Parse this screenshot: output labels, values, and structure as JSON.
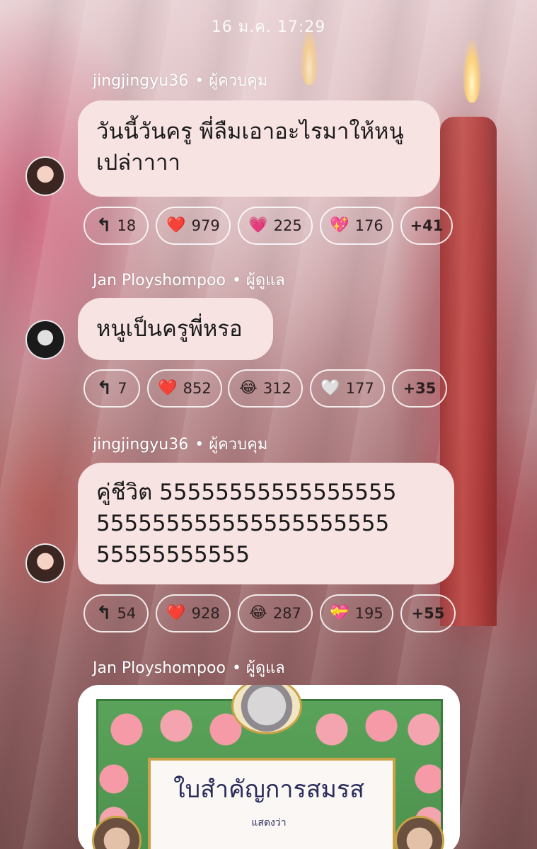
{
  "timestamp": "16 ม.ค. 17:29",
  "messages": [
    {
      "sender": "jingjingyu36",
      "role": "• ผู้ควบคุม",
      "text": "วันนี้วันครู พี่ลืมเอาอะไรมาให้หนูเปล่าาาา",
      "reactions": [
        {
          "icon": "reply-icon",
          "glyph": "↰",
          "count": "18"
        },
        {
          "icon": "red-heart-icon",
          "glyph": "❤️",
          "count": "979"
        },
        {
          "icon": "pink-heart-icon",
          "glyph": "💗",
          "count": "225"
        },
        {
          "icon": "sparkling-heart-icon",
          "glyph": "💖",
          "count": "176"
        },
        {
          "icon": "more-icon",
          "glyph": "",
          "count": "+41"
        }
      ]
    },
    {
      "sender": "Jan Ployshompoo",
      "role": "• ผู้ดูแล",
      "text": "หนูเป็นครูพี่หรอ",
      "reactions": [
        {
          "icon": "reply-icon",
          "glyph": "↰",
          "count": "7"
        },
        {
          "icon": "red-heart-icon",
          "glyph": "❤️",
          "count": "852"
        },
        {
          "icon": "tears-of-joy-icon",
          "glyph": "😂",
          "count": "312"
        },
        {
          "icon": "white-heart-icon",
          "glyph": "🤍",
          "count": "177"
        },
        {
          "icon": "more-icon",
          "glyph": "",
          "count": "+35"
        }
      ]
    },
    {
      "sender": "jingjingyu36",
      "role": "• ผู้ควบคุม",
      "text_lines": [
        "คู่ชีวิต 55555555555555555",
        "555555555555555555555",
        "55555555555"
      ],
      "reactions": [
        {
          "icon": "reply-icon",
          "glyph": "↰",
          "count": "54"
        },
        {
          "icon": "red-heart-icon",
          "glyph": "❤️",
          "count": "928"
        },
        {
          "icon": "tears-of-joy-icon",
          "glyph": "😂",
          "count": "287"
        },
        {
          "icon": "heart-with-ribbon-icon",
          "glyph": "💝",
          "count": "195"
        },
        {
          "icon": "more-icon",
          "glyph": "",
          "count": "+55"
        }
      ]
    },
    {
      "sender": "Jan Ployshompoo",
      "role": "• ผู้ดูแล",
      "image": {
        "title": "ใบสำคัญการสมรส",
        "subtitle": "แสดงว่า"
      }
    }
  ]
}
